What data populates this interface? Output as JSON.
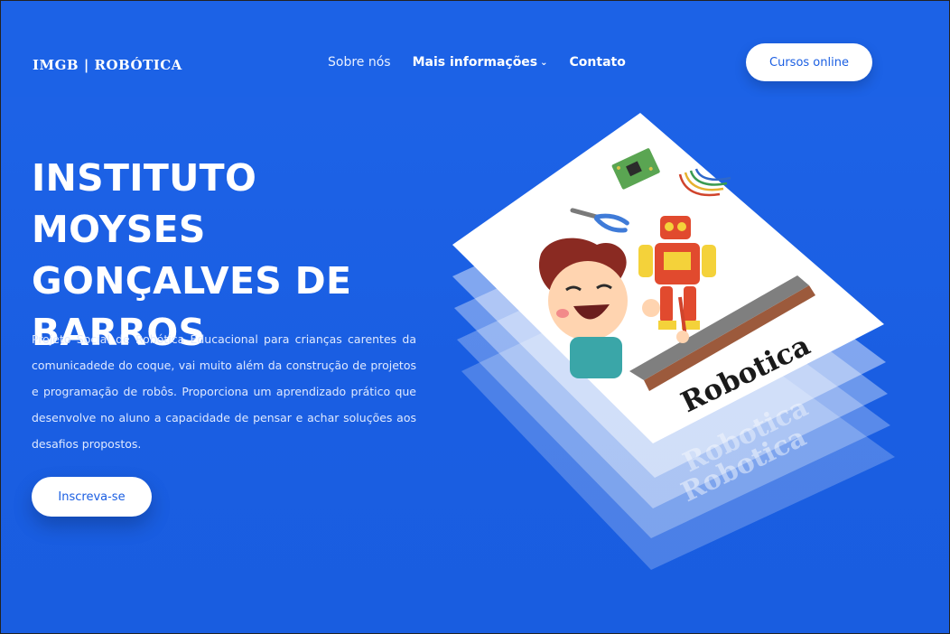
{
  "header": {
    "brand": "IMGB | ROBÓTICA",
    "nav": [
      {
        "label": "Sobre nós"
      },
      {
        "label": "Mais informações"
      },
      {
        "label": "Contato"
      }
    ],
    "cta_label": "Cursos online"
  },
  "hero": {
    "title": "INSTITUTO MOYSES GONÇALVES DE BARROS",
    "description": "Projeto Social de Robótica Educacional para crianças carentes da comunicadede do coque, vai muito além da construção de projetos e programação de robôs. Proporciona um aprendizado prático que desenvolve no aluno a capacidade de pensar e achar soluções aos desafios propostos.",
    "button_label": "Inscreva-se"
  },
  "illustration": {
    "word": "Robotica"
  },
  "colors": {
    "primary": "#1a5ee2",
    "button_bg": "#ffffff"
  }
}
